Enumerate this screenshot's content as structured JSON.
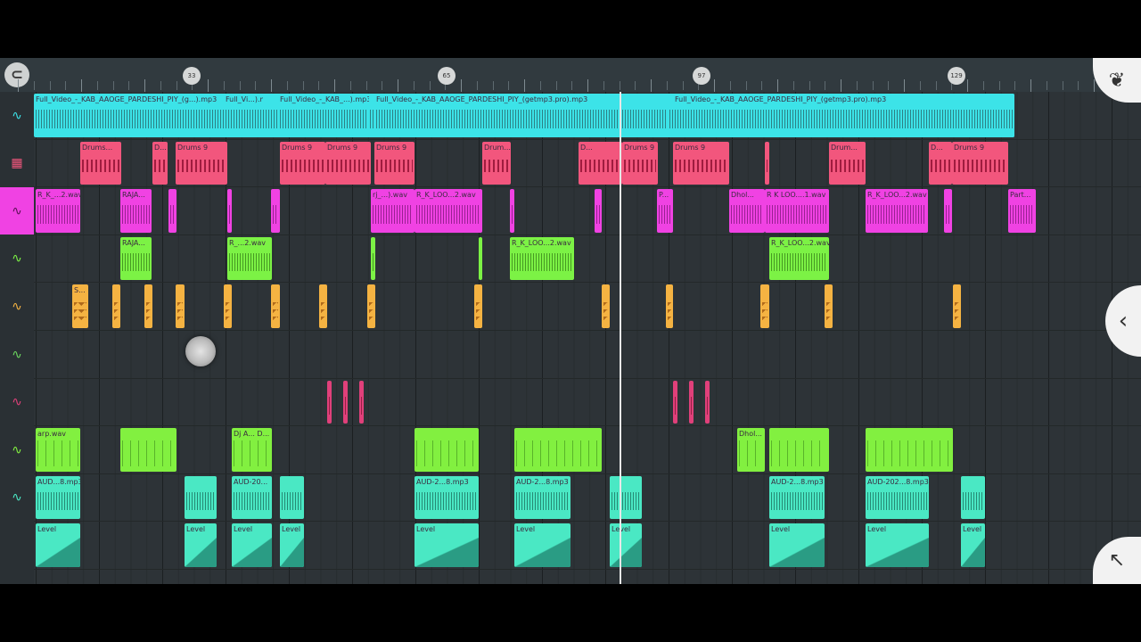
{
  "app": "FL Studio Mobile",
  "ruler": {
    "markers": [
      "33",
      "65",
      "97",
      "129"
    ]
  },
  "icons": {
    "magnet": "magnet-snap-icon",
    "logo": "fl-fruit-logo-icon",
    "expand": "chevron-left-icon",
    "resize": "arrow-up-left-icon"
  },
  "colors": {
    "cyan": "#3ce3e8",
    "pink": "#f2567d",
    "magenta": "#f042e3",
    "green": "#7cf245",
    "orange": "#f5b342",
    "teal": "#4ae8c4",
    "lime": "#82f040"
  },
  "tracks": [
    {
      "icon": "audio-wave-icon",
      "icon_color": "#3ce3e8",
      "clips": [
        {
          "label": "Full_Video_-_KAB_AAOGE_PARDESHI_PIY_(g...).mp3"
        },
        {
          "label": "Full_Vi...).mp3"
        },
        {
          "label": "Full_Video_-_KAB_...).mp3"
        },
        {
          "label": "Full_Video_-_KAB_AAOGE_PARDESHI_PIY_(getmp3.pro).mp3"
        },
        {
          "label": "Full_Video_-_KAB_AAOGE_PARDESHI_PIY_(getmp3.pro).mp3"
        }
      ]
    },
    {
      "icon": "drum-pattern-icon",
      "icon_color": "#f2567d",
      "clips": [
        {
          "label": "Drums..."
        },
        {
          "label": "D..."
        },
        {
          "label": "Drums 9"
        },
        {
          "label": "Drums 9"
        },
        {
          "label": "Drums 9"
        },
        {
          "label": "Drums 9"
        },
        {
          "label": "Drum..."
        },
        {
          "label": "D..."
        },
        {
          "label": "Drums 9"
        },
        {
          "label": "Drums 9"
        },
        {
          "label": ""
        },
        {
          "label": "Drum..."
        },
        {
          "label": "D..."
        },
        {
          "label": "Drums 9"
        }
      ]
    },
    {
      "icon": "audio-wave-icon",
      "icon_color": "#f042e3",
      "clips": [
        {
          "label": "R_K_...2.wav"
        },
        {
          "label": "RAJA..."
        },
        {
          "label": ""
        },
        {
          "label": ""
        },
        {
          "label": ""
        },
        {
          "label": "rj_...).wav"
        },
        {
          "label": "R_K_LOO...2.wav"
        },
        {
          "label": ""
        },
        {
          "label": ""
        },
        {
          "label": "P..."
        },
        {
          "label": "Dhol..."
        },
        {
          "label": "R K LOO....1.wav"
        },
        {
          "label": "R_K_LOO...2.wav"
        },
        {
          "label": ""
        },
        {
          "label": "Part..."
        }
      ]
    },
    {
      "icon": "audio-wave-icon",
      "icon_color": "#7cf245",
      "clips": [
        {
          "label": "RAJA..."
        },
        {
          "label": "R_...2.wav"
        },
        {
          "label": ""
        },
        {
          "label": ""
        },
        {
          "label": "R_K_LOO...2.wav"
        },
        {
          "label": "R_K_LOO...2.wav"
        }
      ]
    },
    {
      "icon": "audio-wave-icon",
      "icon_color": "#f5b342",
      "clips": [
        {
          "label": "S..."
        },
        {
          "label": ""
        },
        {
          "label": ""
        },
        {
          "label": ""
        },
        {
          "label": ""
        },
        {
          "label": ""
        },
        {
          "label": ""
        },
        {
          "label": ""
        },
        {
          "label": ""
        },
        {
          "label": ""
        },
        {
          "label": ""
        },
        {
          "label": ""
        },
        {
          "label": ""
        },
        {
          "label": ""
        }
      ]
    },
    {
      "icon": "audio-wave-icon",
      "icon_color": "#6cd85f",
      "clips": []
    },
    {
      "icon": "audio-wave-icon",
      "icon_color": "#e0407a",
      "clips": [
        {
          "label": ""
        },
        {
          "label": ""
        },
        {
          "label": ""
        },
        {
          "label": ""
        },
        {
          "label": ""
        },
        {
          "label": ""
        }
      ]
    },
    {
      "icon": "audio-wave-icon",
      "icon_color": "#82f040",
      "clips": [
        {
          "label": "arp.wav"
        },
        {
          "label": ""
        },
        {
          "label": "Dj A... D..."
        },
        {
          "label": ""
        },
        {
          "label": ""
        },
        {
          "label": "Dhol..."
        },
        {
          "label": ""
        },
        {
          "label": ""
        }
      ]
    },
    {
      "icon": "audio-wave-icon",
      "icon_color": "#4ae8c4",
      "clips": [
        {
          "label": "AUD...8.mp3"
        },
        {
          "label": ""
        },
        {
          "label": "AUD-20..."
        },
        {
          "label": ""
        },
        {
          "label": "AUD-2...8.mp3"
        },
        {
          "label": "AUD-2...8.mp3"
        },
        {
          "label": ""
        },
        {
          "label": "AUD-2...8.mp3"
        },
        {
          "label": "AUD-202...8.mp3"
        },
        {
          "label": ""
        }
      ]
    },
    {
      "icon": "",
      "icon_color": "#4ae8c4",
      "clips": [
        {
          "label": "Level"
        },
        {
          "label": "Level"
        },
        {
          "label": "Level"
        },
        {
          "label": "Level"
        },
        {
          "label": "Level"
        },
        {
          "label": "Level"
        },
        {
          "label": "Level"
        },
        {
          "label": "Level"
        },
        {
          "label": "Level"
        },
        {
          "label": "Level"
        }
      ]
    }
  ]
}
